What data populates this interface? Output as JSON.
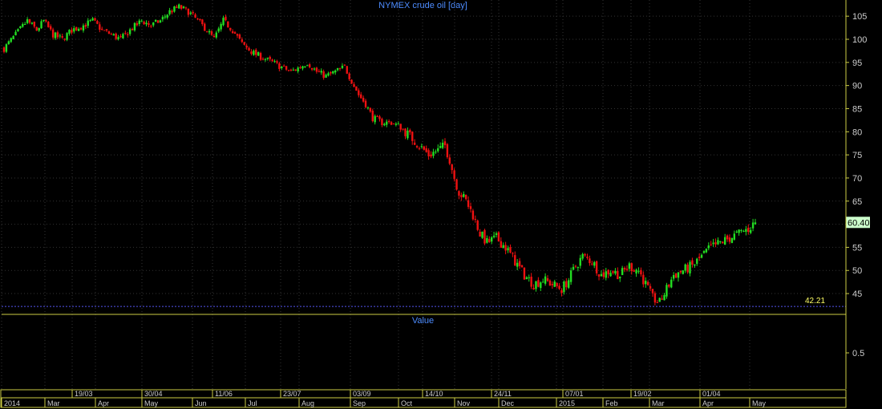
{
  "chart_data": {
    "type": "candlestick",
    "title": "NYMEX crude oil [day]",
    "last_price_label": "60.40",
    "last_price": 60.4,
    "low_line_label": "42.21",
    "low_line": 42.21,
    "ylim": [
      40.5,
      108.5
    ],
    "yticks": [
      "105",
      "100",
      "95",
      "90",
      "85",
      "80",
      "75",
      "70",
      "65",
      "60",
      "55",
      "50",
      "45"
    ],
    "indicator": {
      "title": "Value",
      "tick": "0.5"
    },
    "x_top_labels": [
      "19/03",
      "30/04",
      "11/06",
      "23/07",
      "03/09",
      "14/10",
      "24/11",
      "07/01",
      "19/02",
      "01/04"
    ],
    "x_bottom_labels": [
      "2014",
      "Mar",
      "Apr",
      "May",
      "Jun",
      "Jul",
      "Aug",
      "Sep",
      "Oct",
      "Nov",
      "Dec",
      "2015",
      "Feb",
      "Mar",
      "Apr",
      "May"
    ],
    "close_series": [
      {
        "t": 0,
        "v": 98
      },
      {
        "t": 5,
        "v": 101
      },
      {
        "t": 10,
        "v": 104
      },
      {
        "t": 14,
        "v": 102
      },
      {
        "t": 17,
        "v": 104
      },
      {
        "t": 21,
        "v": 101
      },
      {
        "t": 25,
        "v": 100
      },
      {
        "t": 29,
        "v": 102
      },
      {
        "t": 34,
        "v": 103
      },
      {
        "t": 38,
        "v": 104
      },
      {
        "t": 42,
        "v": 102
      },
      {
        "t": 46,
        "v": 101
      },
      {
        "t": 50,
        "v": 100
      },
      {
        "t": 54,
        "v": 102
      },
      {
        "t": 59,
        "v": 104
      },
      {
        "t": 63,
        "v": 103
      },
      {
        "t": 67,
        "v": 104
      },
      {
        "t": 71,
        "v": 106
      },
      {
        "t": 75,
        "v": 107
      },
      {
        "t": 79,
        "v": 106
      },
      {
        "t": 83,
        "v": 104
      },
      {
        "t": 87,
        "v": 102
      },
      {
        "t": 90,
        "v": 100
      },
      {
        "t": 94,
        "v": 104
      },
      {
        "t": 98,
        "v": 102
      },
      {
        "t": 102,
        "v": 99
      },
      {
        "t": 107,
        "v": 97
      },
      {
        "t": 111,
        "v": 96
      },
      {
        "t": 115,
        "v": 95
      },
      {
        "t": 119,
        "v": 94
      },
      {
        "t": 123,
        "v": 93
      },
      {
        "t": 127,
        "v": 94
      },
      {
        "t": 130,
        "v": 95
      },
      {
        "t": 134,
        "v": 93
      },
      {
        "t": 138,
        "v": 92
      },
      {
        "t": 142,
        "v": 93
      },
      {
        "t": 146,
        "v": 94
      },
      {
        "t": 149,
        "v": 91
      },
      {
        "t": 152,
        "v": 88
      },
      {
        "t": 155,
        "v": 86
      },
      {
        "t": 158,
        "v": 83
      },
      {
        "t": 162,
        "v": 82
      },
      {
        "t": 166,
        "v": 82
      },
      {
        "t": 170,
        "v": 81
      },
      {
        "t": 174,
        "v": 79
      },
      {
        "t": 178,
        "v": 77
      },
      {
        "t": 182,
        "v": 75
      },
      {
        "t": 186,
        "v": 76
      },
      {
        "t": 189,
        "v": 77
      },
      {
        "t": 191,
        "v": 74
      },
      {
        "t": 193,
        "v": 70
      },
      {
        "t": 195,
        "v": 67
      },
      {
        "t": 198,
        "v": 65
      },
      {
        "t": 201,
        "v": 62
      },
      {
        "t": 204,
        "v": 58
      },
      {
        "t": 207,
        "v": 56
      },
      {
        "t": 211,
        "v": 57
      },
      {
        "t": 215,
        "v": 55
      },
      {
        "t": 219,
        "v": 52
      },
      {
        "t": 223,
        "v": 49
      },
      {
        "t": 227,
        "v": 47
      },
      {
        "t": 231,
        "v": 48
      },
      {
        "t": 235,
        "v": 47
      },
      {
        "t": 239,
        "v": 46
      },
      {
        "t": 242,
        "v": 48
      },
      {
        "t": 245,
        "v": 51
      },
      {
        "t": 248,
        "v": 53
      },
      {
        "t": 252,
        "v": 52
      },
      {
        "t": 256,
        "v": 49
      },
      {
        "t": 260,
        "v": 50
      },
      {
        "t": 264,
        "v": 49
      },
      {
        "t": 268,
        "v": 51
      },
      {
        "t": 272,
        "v": 50
      },
      {
        "t": 275,
        "v": 47
      },
      {
        "t": 278,
        "v": 44
      },
      {
        "t": 281,
        "v": 43
      },
      {
        "t": 284,
        "v": 46
      },
      {
        "t": 287,
        "v": 49
      },
      {
        "t": 291,
        "v": 50
      },
      {
        "t": 295,
        "v": 51
      },
      {
        "t": 299,
        "v": 53
      },
      {
        "t": 303,
        "v": 55
      },
      {
        "t": 307,
        "v": 56
      },
      {
        "t": 311,
        "v": 57
      },
      {
        "t": 315,
        "v": 58
      },
      {
        "t": 319,
        "v": 59
      },
      {
        "t": 322,
        "v": 60.4
      }
    ],
    "colors": {
      "up": "#22dd22",
      "down": "#ee1111",
      "grid": "#333333",
      "axis": "#cccc44",
      "title": "#4d8cff",
      "price_box": "#ccffcc",
      "low_line": "#5555ee",
      "low_label": "#ffff66"
    }
  }
}
